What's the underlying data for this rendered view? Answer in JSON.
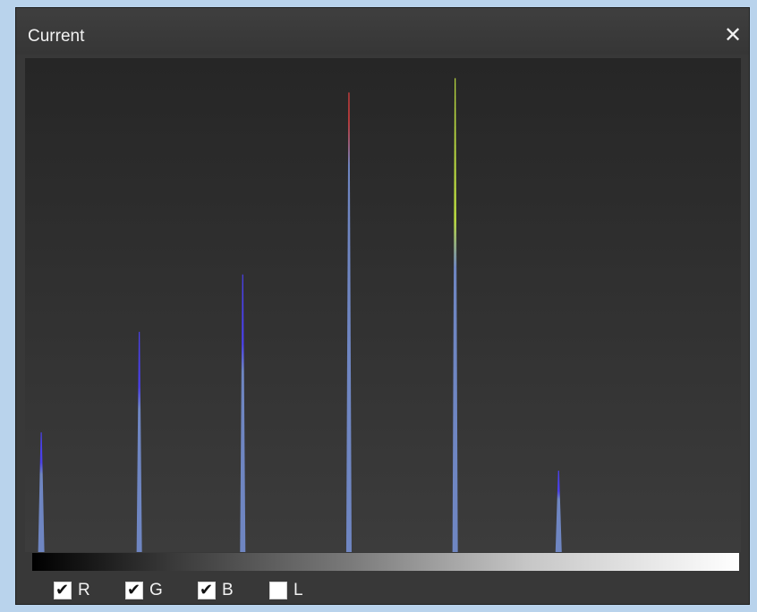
{
  "window": {
    "title": "Current",
    "close_glyph": "✕"
  },
  "channels": [
    {
      "label": "R",
      "checked": true
    },
    {
      "label": "G",
      "checked": true
    },
    {
      "label": "B",
      "checked": true
    },
    {
      "label": "L",
      "checked": false
    }
  ],
  "colors": {
    "background": "#b9d3ec",
    "panel": "#383838",
    "spike_base": "#6f86c2",
    "red_channel": "#e04040",
    "green_channel": "#b8d840",
    "blue_channel": "#4a40e8"
  },
  "chart_data": {
    "type": "histogram",
    "title": "",
    "xlabel": "",
    "ylabel": "",
    "xlim": [
      0,
      255
    ],
    "ylim": [
      0,
      1
    ],
    "grid": false,
    "spikes": [
      {
        "x": 2,
        "height": 0.25,
        "tip": "blue"
      },
      {
        "x": 38,
        "height": 0.46,
        "tip": "blue"
      },
      {
        "x": 76,
        "height": 0.58,
        "tip": "blue"
      },
      {
        "x": 115,
        "height": 0.96,
        "tip": "red"
      },
      {
        "x": 154,
        "height": 0.99,
        "tip": "green"
      },
      {
        "x": 192,
        "height": 0.17,
        "tip": "blue"
      }
    ]
  }
}
